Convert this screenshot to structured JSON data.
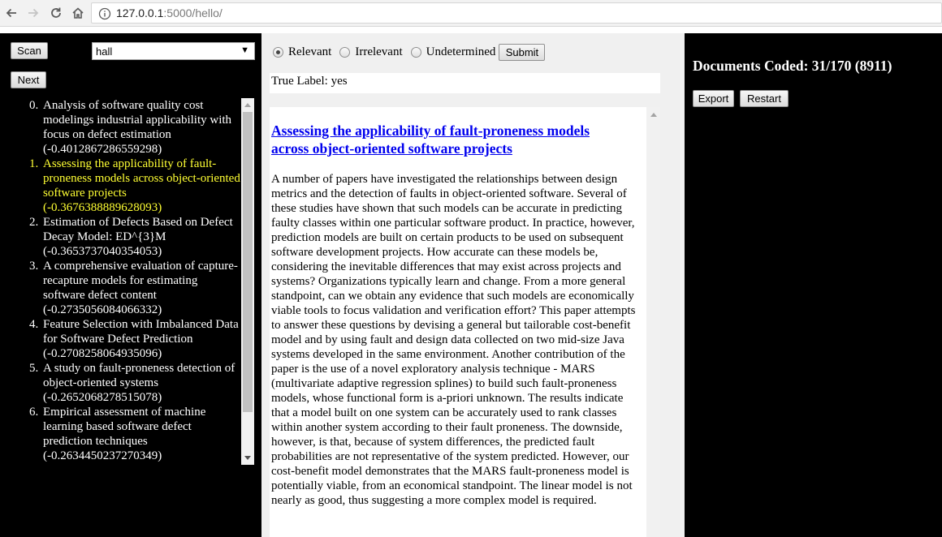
{
  "browser": {
    "url_host": "127.0.0.1",
    "url_rest": ":5000/hello/"
  },
  "left_panel": {
    "scan_label": "Scan",
    "next_label": "Next",
    "dropdown_selected": "hall",
    "documents": [
      {
        "index": "0.",
        "title": "Analysis of software quality cost modelings industrial applicability with focus on defect estimation",
        "score": "(-0.4012867286559298)"
      },
      {
        "index": "1.",
        "title": "Assessing the applicability of fault-proneness models across object-oriented software projects",
        "score": "(-0.3676388889628093)"
      },
      {
        "index": "2.",
        "title": "Estimation of Defects Based on Defect Decay Model: ED^{3}M",
        "score": "(-0.3653737040354053)"
      },
      {
        "index": "3.",
        "title": "A comprehensive evaluation of capture-recapture models for estimating software defect content",
        "score": "(-0.2735056084066332)"
      },
      {
        "index": "4.",
        "title": "Feature Selection with Imbalanced Data for Software Defect Prediction",
        "score": "(-0.2708258064935096)"
      },
      {
        "index": "5.",
        "title": "A study on fault-proneness detection of object-oriented systems",
        "score": "(-0.2652068278515078)"
      },
      {
        "index": "6.",
        "title": "Empirical assessment of machine learning based software defect prediction techniques",
        "score": "(-0.2634450237270349)"
      }
    ]
  },
  "center_panel": {
    "radio_relevant": "Relevant",
    "radio_irrelevant": "Irrelevant",
    "radio_undetermined": "Undetermined",
    "submit_label": "Submit",
    "true_label": "True Label: yes",
    "doc_title": "Assessing the applicability of fault-proneness models across object-oriented software projects",
    "doc_abstract": "A number of papers have investigated the relationships between design metrics and the detection of faults in object-oriented software. Several of these studies have shown that such models can be accurate in predicting faulty classes within one particular software product. In practice, however, prediction models are built on certain products to be used on subsequent software development projects. How accurate can these models be, considering the inevitable differences that may exist across projects and systems? Organizations typically learn and change. From a more general standpoint, can we obtain any evidence that such models are economically viable tools to focus validation and verification effort? This paper attempts to answer these questions by devising a general but tailorable cost-benefit model and by using fault and design data collected on two mid-size Java systems developed in the same environment. Another contribution of the paper is the use of a novel exploratory analysis technique - MARS (multivariate adaptive regression splines) to build such fault-proneness models, whose functional form is a-priori unknown. The results indicate that a model built on one system can be accurately used to rank classes within another system according to their fault proneness. The downside, however, is that, because of system differences, the predicted fault probabilities are not representative of the system predicted. However, our cost-benefit model demonstrates that the MARS fault-proneness model is potentially viable, from an economical standpoint. The linear model is not nearly as good, thus suggesting a more complex model is required."
  },
  "right_panel": {
    "documents_coded": "Documents Coded: 31/170 (8911)",
    "export_label": "Export",
    "restart_label": "Restart"
  },
  "colors": {
    "panel_bg": "#000000",
    "center_bg": "#f0f0f0",
    "active_item": "#ffff33",
    "link": "#0000ee"
  }
}
